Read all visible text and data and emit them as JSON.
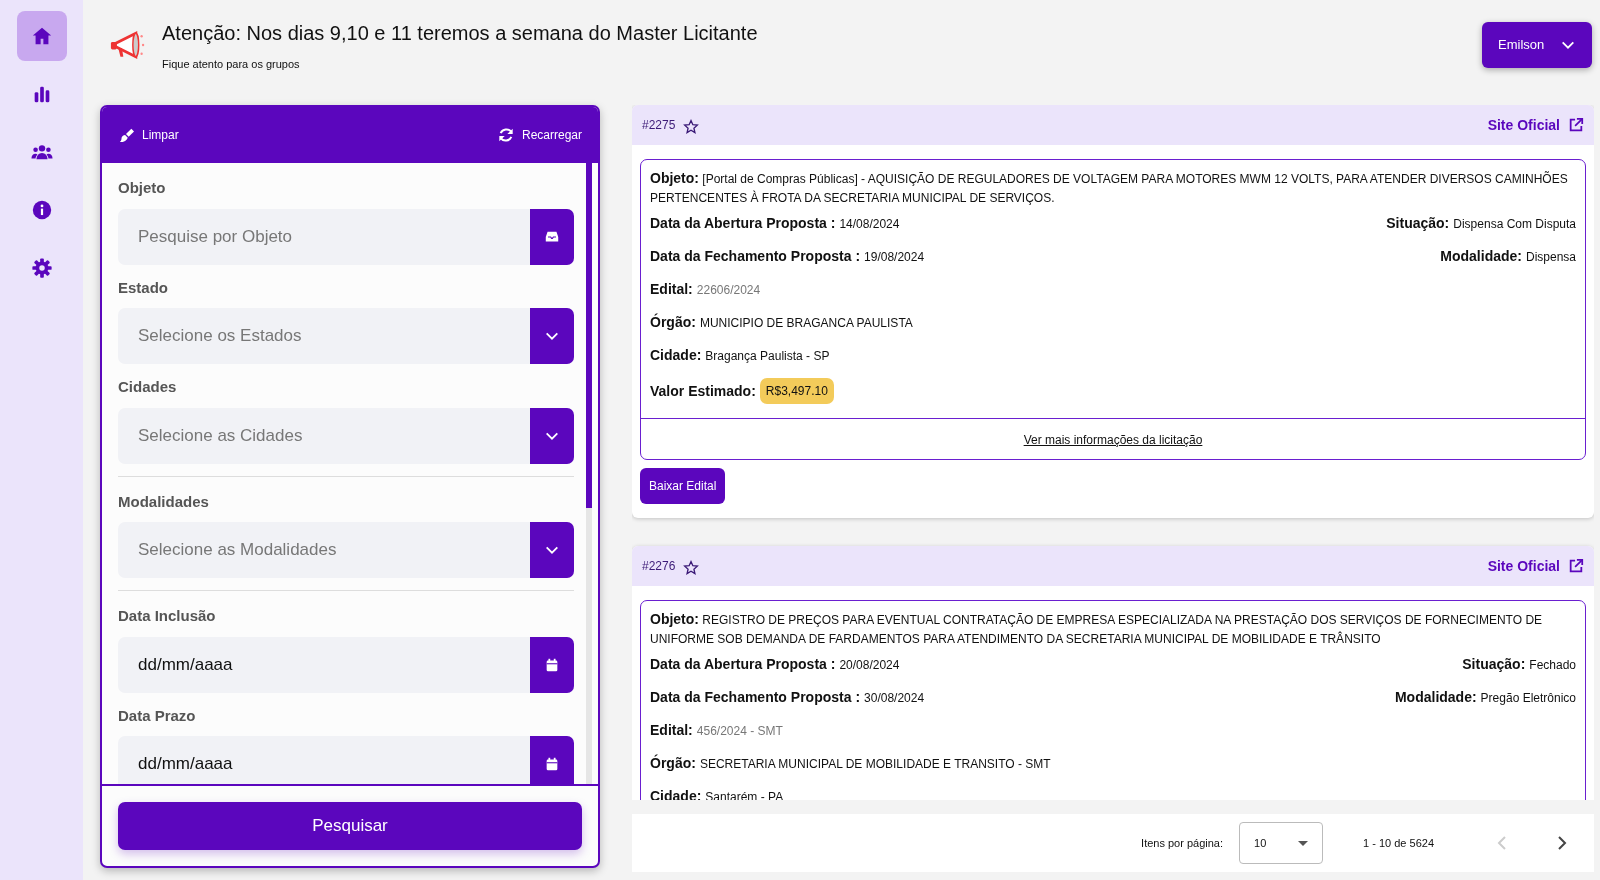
{
  "sidebar": {
    "items": [
      {
        "kind": "home",
        "selected": true
      },
      {
        "kind": "chart",
        "selected": false
      },
      {
        "kind": "users",
        "selected": false
      },
      {
        "kind": "info",
        "selected": false
      },
      {
        "kind": "settings",
        "selected": false
      }
    ]
  },
  "announcement": {
    "title": "Atenção: Nos dias 9,10 e 11 teremos a semana do Master Licitante",
    "subtitle": "Fique atento para os grupos"
  },
  "user_menu": {
    "label": "Emilson"
  },
  "filters": {
    "actions": [
      {
        "kind": "clear",
        "label": "Limpar"
      },
      {
        "kind": "reload",
        "label": "Recarregar"
      }
    ],
    "fields": [
      {
        "kind": "text",
        "label": "Objeto",
        "placeholder": "Pesquise por Objeto"
      },
      {
        "kind": "select",
        "label": "Estado",
        "placeholder": "Selecione os Estados"
      },
      {
        "kind": "select",
        "label": "Cidades",
        "placeholder": "Selecione as Cidades"
      },
      {
        "kind": "divider"
      },
      {
        "kind": "select",
        "label": "Modalidades",
        "placeholder": "Selecione as Modalidades"
      },
      {
        "kind": "divider"
      },
      {
        "kind": "date",
        "label": "Data Inclusão",
        "placeholder": "dd/mm/aaaa"
      },
      {
        "kind": "date",
        "label": "Data Prazo",
        "placeholder": "dd/mm/aaaa"
      }
    ],
    "submit": "Pesquisar"
  },
  "bids": [
    {
      "number": "#2275",
      "favorite": false,
      "site_link": "Site Oficial",
      "objeto": {
        "label": "Objeto:",
        "value": "[Portal de Compras Públicas] - AQUISIÇÃO DE REGULADORES DE VOLTAGEM PARA MOTORES MWM 12 VOLTS, PARA ATENDER DIVERSOS CAMINHÕES PERTENCENTES À FROTA DA SECRETARIA MUNICIPAL DE SERVIÇOS."
      },
      "rows": [
        {
          "left": {
            "kind": "text",
            "label": "Data da Abertura Proposta :",
            "value": "14/08/2024"
          },
          "right": {
            "kind": "text",
            "label": "Situação:",
            "value": "Dispensa Com Disputa"
          }
        },
        {
          "left": {
            "kind": "text",
            "label": "Data da Fechamento Proposta :",
            "value": "19/08/2024"
          },
          "right": {
            "kind": "text",
            "label": "Modalidade:",
            "value": "Dispensa"
          }
        },
        {
          "left": {
            "kind": "muted",
            "label": "Edital:",
            "value": "22606/2024"
          }
        },
        {
          "left": {
            "kind": "text",
            "label": "Órgão:",
            "value": "MUNICIPIO DE BRAGANCA PAULISTA"
          }
        },
        {
          "left": {
            "kind": "text",
            "label": "Cidade:",
            "value": "Bragança Paulista - SP"
          }
        },
        {
          "left": {
            "kind": "badge",
            "label": "Valor Estimado:",
            "value": "R$3,497.10"
          }
        }
      ],
      "more_link": "Ver mais informações da licitação",
      "download_button": "Baixar Edital"
    },
    {
      "number": "#2276",
      "favorite": false,
      "site_link": "Site Oficial",
      "objeto": {
        "label": "Objeto:",
        "value": "REGISTRO DE PREÇOS PARA EVENTUAL CONTRATAÇÃO DE EMPRESA ESPECIALIZADA NA PRESTAÇÃO DOS SERVIÇOS DE FORNECIMENTO DE UNIFORME SOB DEMANDA DE FARDAMENTOS PARA ATENDIMENTO DA SECRETARIA MUNICIPAL DE MOBILIDADE E TRÂNSITO"
      },
      "rows": [
        {
          "left": {
            "kind": "text",
            "label": "Data da Abertura Proposta :",
            "value": "20/08/2024"
          },
          "right": {
            "kind": "text",
            "label": "Situação:",
            "value": "Fechado"
          }
        },
        {
          "left": {
            "kind": "text",
            "label": "Data da Fechamento Proposta :",
            "value": "30/08/2024"
          },
          "right": {
            "kind": "text",
            "label": "Modalidade:",
            "value": "Pregão Eletrônico"
          }
        },
        {
          "left": {
            "kind": "muted",
            "label": "Edital:",
            "value": "456/2024 - SMT"
          }
        },
        {
          "left": {
            "kind": "text",
            "label": "Órgão:",
            "value": "SECRETARIA MUNICIPAL DE MOBILIDADE E TRANSITO - SMT"
          }
        },
        {
          "left": {
            "kind": "text",
            "label": "Cidade:",
            "value": "Santarém - PA"
          }
        }
      ]
    }
  ],
  "pagination": {
    "label": "Itens por página:",
    "page_size": "10",
    "range": "1 - 10 de 5624",
    "prev_disabled": true,
    "next_disabled": false
  }
}
